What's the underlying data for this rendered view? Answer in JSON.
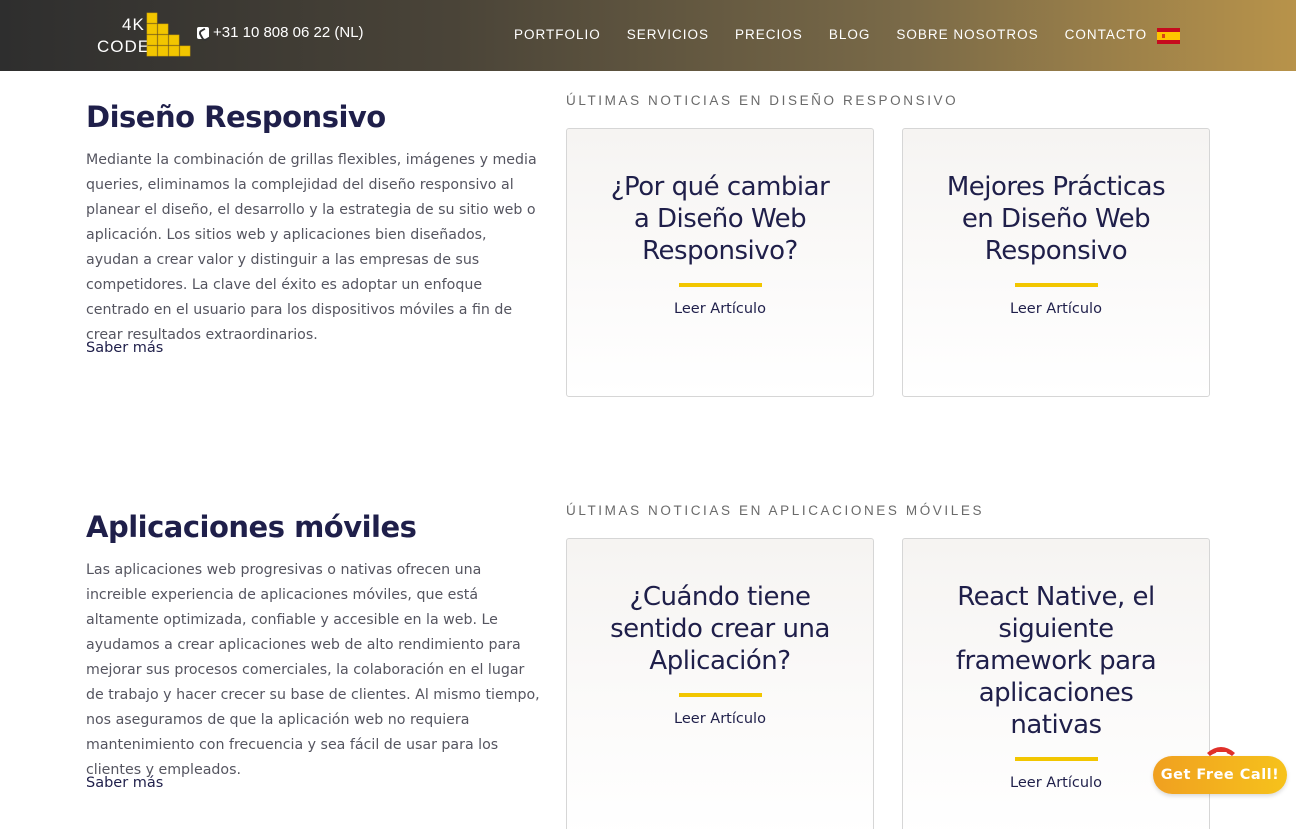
{
  "header": {
    "logo_top": "4K",
    "logo_bottom": "CODE",
    "phone": "+31 10 808 06 22 (NL)",
    "nav": [
      "PORTFOLIO",
      "SERVICIOS",
      "PRECIOS",
      "BLOG",
      "SOBRE NOSOTROS",
      "CONTACTO"
    ],
    "flag_icon": "spain-flag-icon"
  },
  "sections": [
    {
      "title": "Diseño Responsivo",
      "body": "Mediante la combinación de grillas flexibles, imágenes y media queries, eliminamos la complejidad del diseño responsivo al planear el diseño, el desarrollo y la estrategia de su sitio web o aplicación. Los sitios web y aplicaciones bien diseñados, ayudan a crear valor y distinguir a las empresas de sus competidores. La clave del éxito es adoptar un enfoque centrado en el usuario para los dispositivos móviles a fin de crear resultados extraordinarios.",
      "link": "Saber más",
      "news_label": "Últimas noticias en Diseño Responsivo",
      "cards": [
        {
          "title": "¿Por qué cambiar a Diseño Web Responsivo?",
          "link": "Leer Artículo"
        },
        {
          "title": "Mejores Prácticas en Diseño Web Responsivo",
          "link": "Leer Artículo"
        }
      ]
    },
    {
      "title": "Aplicaciones móviles",
      "body": "Las aplicaciones web progresivas o nativas ofrecen una increible experiencia de aplicaciones móviles, que está altamente optimizada, confiable y accesible en la web. Le ayudamos a crear aplicaciones web de alto rendimiento para mejorar sus procesos comerciales, la colaboración en el lugar de trabajo y hacer crecer su base de clientes. Al mismo tiempo, nos aseguramos de que la aplicación web no requiera mantenimiento con frecuencia y sea fácil de usar para los clientes y empleados.",
      "link": "Saber más",
      "news_label": "Últimas noticias en Aplicaciones Móviles",
      "cards": [
        {
          "title": "¿Cuándo tiene sentido crear una Aplicación?",
          "link": "Leer Artículo"
        },
        {
          "title": "React Native, el siguiente framework para aplicaciones nativas",
          "link": "Leer Artículo"
        }
      ]
    }
  ],
  "cta": {
    "label": "Get Free Call!"
  },
  "colors": {
    "accent": "#f2c600",
    "heading": "#1f1f4a",
    "cta": "#f6b21c"
  }
}
